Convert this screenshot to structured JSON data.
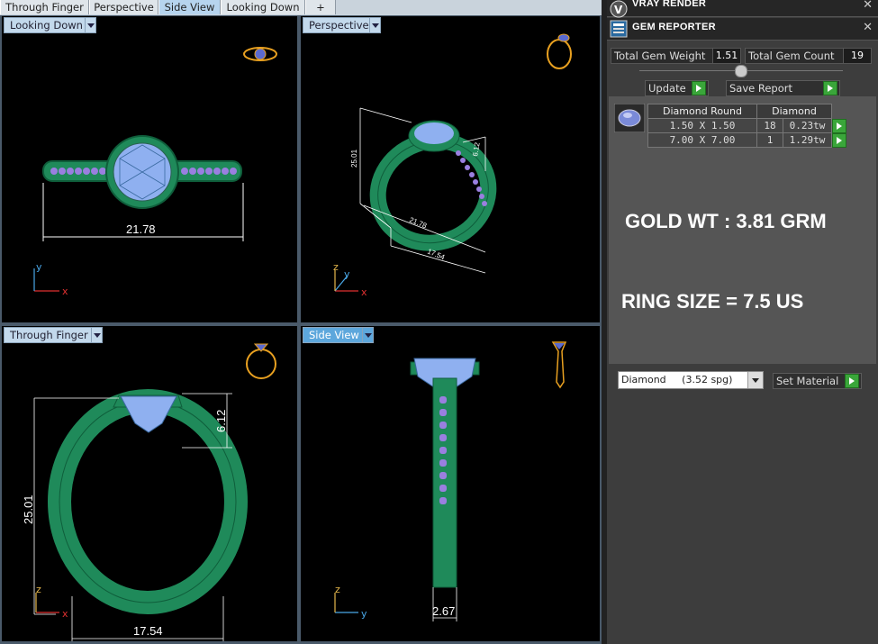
{
  "tabs": [
    {
      "label": "Through Finger"
    },
    {
      "label": "Perspective"
    },
    {
      "label": "Side View"
    },
    {
      "label": "Looking Down"
    },
    {
      "label": "+"
    }
  ],
  "viewports": {
    "top_left": {
      "label": "Looking Down",
      "dim": "21.78",
      "axis_x": "x",
      "axis_y": "y"
    },
    "top_right": {
      "label": "Perspective",
      "dim_a": "25.01",
      "dim_b": "6.12",
      "dim_c": "21.78",
      "dim_d": "17.54",
      "axis_x": "x",
      "axis_y": "y",
      "axis_z": "z"
    },
    "bottom_left": {
      "label": "Through Finger",
      "dim_h": "25.01",
      "dim_top": "6.12",
      "dim_w": "17.54",
      "axis_x": "x",
      "axis_z": "z"
    },
    "bottom_right": {
      "label": "Side View",
      "dim_w": "2.67",
      "axis_y": "y",
      "axis_z": "z"
    }
  },
  "panel": {
    "vray_title": "VRAY RENDER",
    "gem_title": "GEM REPORTER",
    "close_glyph": "✕",
    "total_weight_label": "Total Gem Weight",
    "total_weight_value": "1.51",
    "total_count_label": "Total Gem Count",
    "total_count_value": "19",
    "update_label": "Update",
    "save_label": "Save Report",
    "table": {
      "header": [
        "Diamond Round",
        "Diamond"
      ],
      "rows": [
        {
          "size": "1.50 X 1.50",
          "count": "18",
          "weight": "0.23tw"
        },
        {
          "size": "7.00 X 7.00",
          "count": "1",
          "weight": "1.29tw"
        }
      ]
    },
    "gold_wt": "GOLD WT : 3.81 GRM",
    "ring_size": "RING SIZE = 7.5 US",
    "material_name": "Diamond",
    "material_sg": "(3.52 spg)",
    "set_material_label": "Set Material"
  },
  "colors": {
    "metal": "#1f8a5a",
    "metal_dark": "#0f5e3b",
    "gem": "#8fb0f0",
    "gem_small": "#9a7fe0",
    "gizmo": "#e8a020",
    "axis_x": "#e03030",
    "axis_y": "#4aa8e8",
    "axis_z": "#e6b84c"
  }
}
